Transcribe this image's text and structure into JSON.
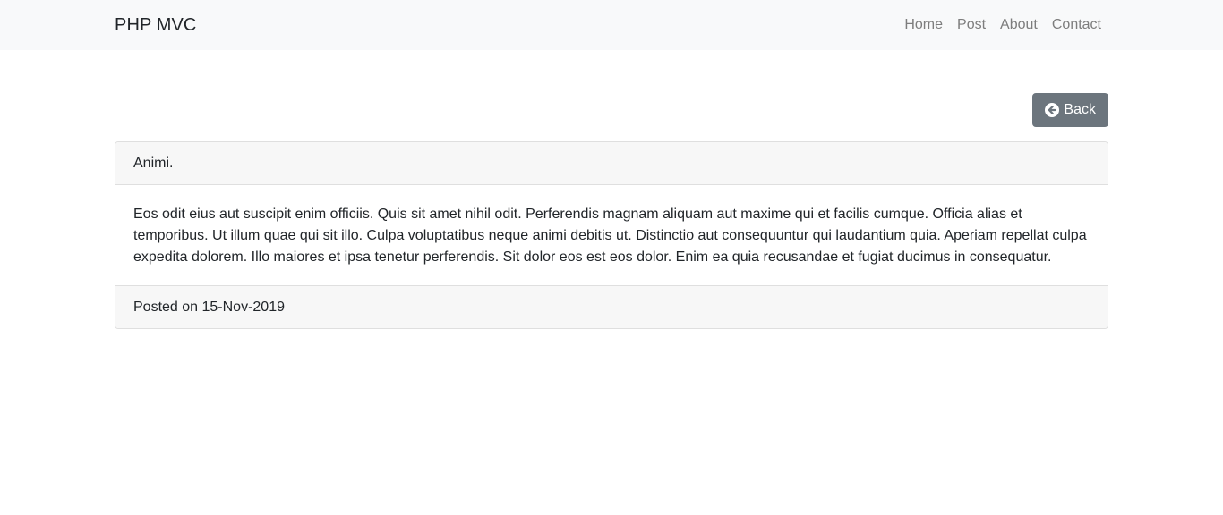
{
  "navbar": {
    "brand": "PHP MVC",
    "links": [
      {
        "label": "Home"
      },
      {
        "label": "Post"
      },
      {
        "label": "About"
      },
      {
        "label": "Contact"
      }
    ]
  },
  "actions": {
    "back_label": "Back",
    "back_icon": "arrow-circle-left-icon"
  },
  "post": {
    "title": "Animi.",
    "body": "Eos odit eius aut suscipit enim officiis. Quis sit amet nihil odit. Perferendis magnam aliquam aut maxime qui et facilis cumque. Officia alias et temporibus. Ut illum quae qui sit illo. Culpa voluptatibus neque animi debitis ut. Distinctio aut consequuntur qui laudantium quia. Aperiam repellat culpa expedita dolorem. Illo maiores et ipsa tenetur perferendis. Sit dolor eos est eos dolor. Enim ea quia recusandae et fugiat ducimus in consequatur.",
    "footer": "Posted on 15-Nov-2019"
  },
  "colors": {
    "navbar_bg": "#f8f9fa",
    "button_bg": "#6c757d",
    "nav_link": "#7d7d7d"
  }
}
